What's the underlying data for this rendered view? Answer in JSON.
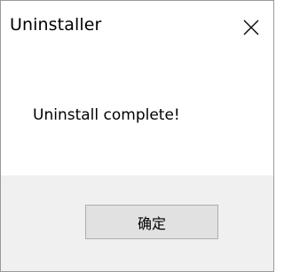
{
  "window": {
    "title": "Uninstaller",
    "close_icon": "close-icon"
  },
  "body": {
    "message": "Uninstall complete!"
  },
  "footer": {
    "ok_label": "确定"
  },
  "colors": {
    "footer_background": "#f0f0f0",
    "button_background": "#e1e1e1",
    "button_border": "#adadad",
    "window_border": "#9a9a9a"
  }
}
